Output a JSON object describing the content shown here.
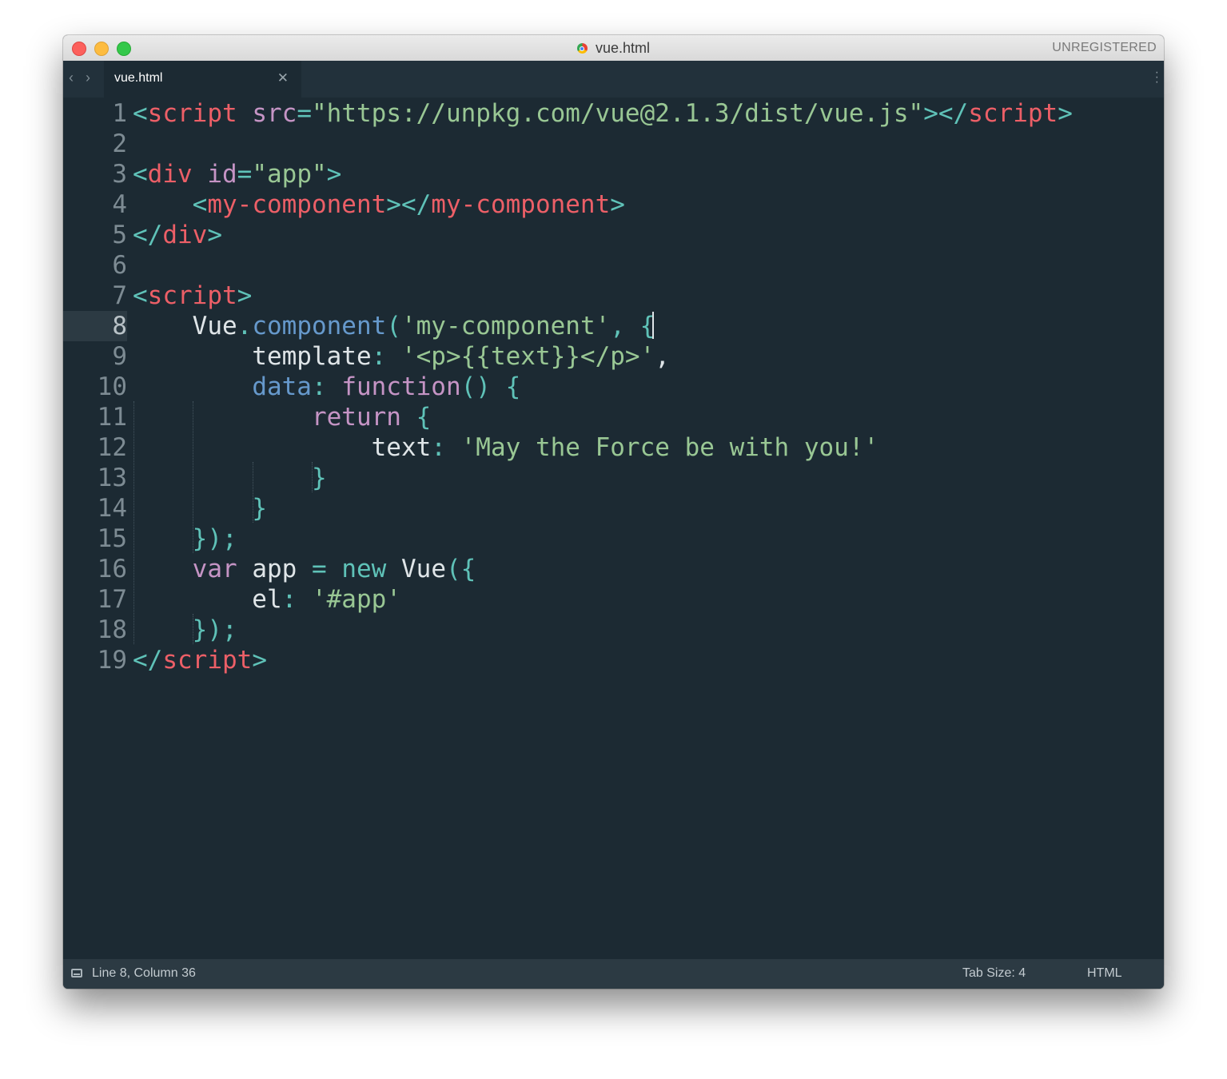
{
  "window": {
    "title": "vue.html",
    "registration": "UNREGISTERED"
  },
  "tabs": [
    {
      "label": "vue.html",
      "active": true
    }
  ],
  "editor": {
    "active_line": 8,
    "line_numbers": [
      "1",
      "2",
      "3",
      "4",
      "5",
      "6",
      "7",
      "8",
      "9",
      "10",
      "11",
      "12",
      "13",
      "14",
      "15",
      "16",
      "17",
      "18",
      "19"
    ],
    "lines": [
      [
        [
          "punc",
          "<"
        ],
        [
          "tag",
          "script"
        ],
        [
          "plain",
          " "
        ],
        [
          "attr",
          "src"
        ],
        [
          "punc",
          "="
        ],
        [
          "str",
          "\"https://unpkg.com/vue@2.1.3/dist/vue.js\""
        ],
        [
          "punc",
          ">"
        ],
        [
          "punc",
          "</"
        ],
        [
          "tag",
          "script"
        ],
        [
          "punc",
          ">"
        ]
      ],
      [],
      [
        [
          "punc",
          "<"
        ],
        [
          "tag",
          "div"
        ],
        [
          "plain",
          " "
        ],
        [
          "attr",
          "id"
        ],
        [
          "punc",
          "="
        ],
        [
          "str",
          "\"app\""
        ],
        [
          "punc",
          ">"
        ]
      ],
      [
        [
          "plain",
          "    "
        ],
        [
          "punc",
          "<"
        ],
        [
          "tag",
          "my-component"
        ],
        [
          "punc",
          ">"
        ],
        [
          "punc",
          "</"
        ],
        [
          "tag",
          "my-component"
        ],
        [
          "punc",
          ">"
        ]
      ],
      [
        [
          "punc",
          "</"
        ],
        [
          "tag",
          "div"
        ],
        [
          "punc",
          ">"
        ]
      ],
      [],
      [
        [
          "punc",
          "<"
        ],
        [
          "tag",
          "script"
        ],
        [
          "punc",
          ">"
        ]
      ],
      [
        [
          "plain",
          "    Vue"
        ],
        [
          "punc",
          "."
        ],
        [
          "func",
          "component"
        ],
        [
          "punc",
          "("
        ],
        [
          "str",
          "'my-component'"
        ],
        [
          "punc",
          ","
        ],
        [
          "plain",
          " "
        ],
        [
          "punc",
          "{"
        ]
      ],
      [
        [
          "plain",
          "        template"
        ],
        [
          "punc",
          ":"
        ],
        [
          "plain",
          " "
        ],
        [
          "str",
          "'<p>{{text}}</p>'"
        ],
        [
          "plain",
          ","
        ]
      ],
      [
        [
          "plain",
          "        "
        ],
        [
          "func",
          "data"
        ],
        [
          "punc",
          ":"
        ],
        [
          "plain",
          " "
        ],
        [
          "kw",
          "function"
        ],
        [
          "punc",
          "()"
        ],
        [
          "plain",
          " "
        ],
        [
          "punc",
          "{"
        ]
      ],
      [
        [
          "plain",
          "            "
        ],
        [
          "kw",
          "return"
        ],
        [
          "plain",
          " "
        ],
        [
          "punc",
          "{"
        ]
      ],
      [
        [
          "plain",
          "                text"
        ],
        [
          "punc",
          ":"
        ],
        [
          "plain",
          " "
        ],
        [
          "str",
          "'May the Force be with you!'"
        ]
      ],
      [
        [
          "plain",
          "            "
        ],
        [
          "punc",
          "}"
        ]
      ],
      [
        [
          "plain",
          "        "
        ],
        [
          "punc",
          "}"
        ]
      ],
      [
        [
          "plain",
          "    "
        ],
        [
          "punc",
          "});"
        ]
      ],
      [
        [
          "plain",
          "    "
        ],
        [
          "kw",
          "var"
        ],
        [
          "plain",
          " app "
        ],
        [
          "op",
          "="
        ],
        [
          "plain",
          " "
        ],
        [
          "op",
          "new"
        ],
        [
          "plain",
          " Vue"
        ],
        [
          "punc",
          "({"
        ]
      ],
      [
        [
          "plain",
          "        el"
        ],
        [
          "punc",
          ":"
        ],
        [
          "plain",
          " "
        ],
        [
          "str",
          "'#app'"
        ]
      ],
      [
        [
          "plain",
          "    "
        ],
        [
          "punc",
          "});"
        ]
      ],
      [
        [
          "punc",
          "</"
        ],
        [
          "tag",
          "script"
        ],
        [
          "punc",
          ">"
        ]
      ]
    ]
  },
  "statusbar": {
    "position": "Line 8, Column 36",
    "tab_size": "Tab Size: 4",
    "syntax": "HTML"
  },
  "icons": {
    "nav_back": "chevron-left-icon",
    "nav_forward": "chevron-right-icon",
    "tab_close": "close-icon",
    "tab_menu": "more-vertical-icon",
    "status_panel": "panel-toggle-icon"
  },
  "colors": {
    "editor_background": "#1c2a33",
    "tag": "#ec5f67",
    "punctuation": "#5fc2b8",
    "attribute": "#c594c5",
    "string": "#99c794",
    "function": "#6699cc",
    "keyword": "#c594c5",
    "plain": "#dfe5e8"
  }
}
